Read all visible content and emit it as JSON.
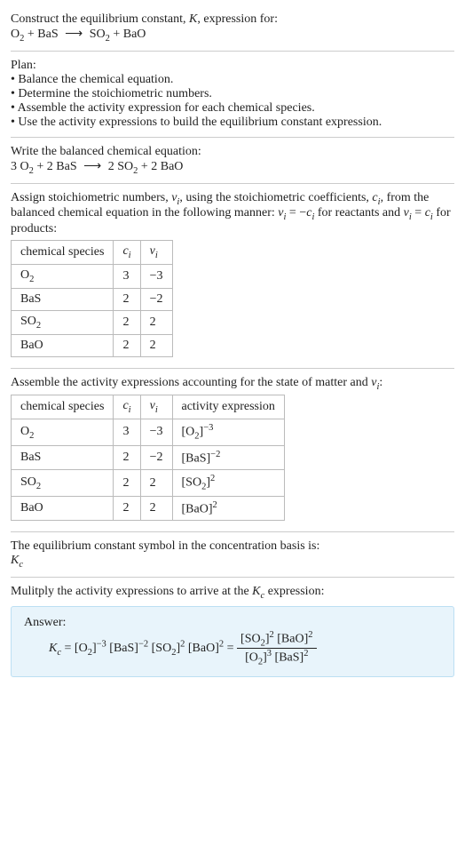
{
  "header": {
    "line1": "Construct the equilibrium constant, ",
    "K": "K",
    "line1b": ", expression for:",
    "eq_lhs1": "O",
    "eq_lhs1_sub": "2",
    "eq_plus1": " + BaS ",
    "eq_arrow": "⟶",
    "eq_rhs1": " SO",
    "eq_rhs1_sub": "2",
    "eq_rhs2": " + BaO"
  },
  "plan": {
    "title": "Plan:",
    "b1": "• Balance the chemical equation.",
    "b2": "• Determine the stoichiometric numbers.",
    "b3": "• Assemble the activity expression for each chemical species.",
    "b4": "• Use the activity expressions to build the equilibrium constant expression."
  },
  "balanced": {
    "title": "Write the balanced chemical equation:",
    "c1": "3 O",
    "c1s": "2",
    "plus1": " + 2 BaS ",
    "arrow": "⟶",
    "c2": " 2 SO",
    "c2s": "2",
    "c3": " + 2 BaO"
  },
  "stoich": {
    "intro1": "Assign stoichiometric numbers, ",
    "nu": "ν",
    "sub_i": "i",
    "intro2": ", using the stoichiometric coefficients, ",
    "c": "c",
    "intro3": ", from the balanced chemical equation in the following manner: ",
    "rel1a": "ν",
    "rel1b": " = −",
    "rel1c": "c",
    "intro4": " for reactants and ",
    "rel2a": "ν",
    "rel2b": " = ",
    "rel2c": "c",
    "intro5": " for products:",
    "headers": {
      "h1": "chemical species",
      "h2": "c",
      "h2s": "i",
      "h3": "ν",
      "h3s": "i"
    },
    "rows": [
      {
        "sp": "O",
        "sps": "2",
        "sp2": "",
        "c": "3",
        "nu": "−3"
      },
      {
        "sp": "BaS",
        "sps": "",
        "sp2": "",
        "c": "2",
        "nu": "−2"
      },
      {
        "sp": "SO",
        "sps": "2",
        "sp2": "",
        "c": "2",
        "nu": "2"
      },
      {
        "sp": "BaO",
        "sps": "",
        "sp2": "",
        "c": "2",
        "nu": "2"
      }
    ]
  },
  "activity": {
    "intro": "Assemble the activity expressions accounting for the state of matter and ",
    "nu": "ν",
    "sub_i": "i",
    "colon": ":",
    "headers": {
      "h1": "chemical species",
      "h2": "c",
      "h2s": "i",
      "h3": "ν",
      "h3s": "i",
      "h4": "activity expression"
    },
    "rows": [
      {
        "sp": "O",
        "sps": "2",
        "c": "3",
        "nu": "−3",
        "ae_base": "[O",
        "ae_sub": "2",
        "ae_close": "]",
        "ae_pow": "−3"
      },
      {
        "sp": "BaS",
        "sps": "",
        "c": "2",
        "nu": "−2",
        "ae_base": "[BaS",
        "ae_sub": "",
        "ae_close": "]",
        "ae_pow": "−2"
      },
      {
        "sp": "SO",
        "sps": "2",
        "c": "2",
        "nu": "2",
        "ae_base": "[SO",
        "ae_sub": "2",
        "ae_close": "]",
        "ae_pow": "2"
      },
      {
        "sp": "BaO",
        "sps": "",
        "c": "2",
        "nu": "2",
        "ae_base": "[BaO",
        "ae_sub": "",
        "ae_close": "]",
        "ae_pow": "2"
      }
    ]
  },
  "symbol": {
    "line": "The equilibrium constant symbol in the concentration basis is:",
    "K": "K",
    "Ks": "c"
  },
  "multiply": {
    "line1": "Mulitply the activity expressions to arrive at the ",
    "K": "K",
    "Ks": "c",
    "line2": " expression:"
  },
  "answer": {
    "label": "Answer:",
    "K": "K",
    "Ks": "c",
    "eq": " = ",
    "t1": "[O",
    "t1s": "2",
    "t1c": "]",
    "t1p": "−3",
    "t2": " [BaS]",
    "t2p": "−2",
    "t3": " [SO",
    "t3s": "2",
    "t3c": "]",
    "t3p": "2",
    "t4": " [BaO]",
    "t4p": "2",
    "eq2": " = ",
    "num1": "[SO",
    "num1s": "2",
    "num1c": "]",
    "num1p": "2",
    "num2": " [BaO]",
    "num2p": "2",
    "den1": "[O",
    "den1s": "2",
    "den1c": "]",
    "den1p": "3",
    "den2": " [BaS]",
    "den2p": "2"
  }
}
